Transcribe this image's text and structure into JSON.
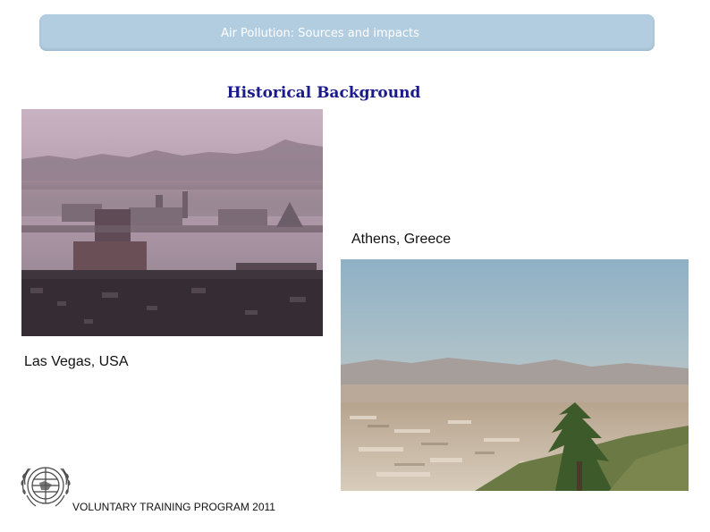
{
  "header": {
    "title": "Air Pollution: Sources and impacts"
  },
  "slide": {
    "title": "Historical Background"
  },
  "photos": {
    "las_vegas": {
      "caption": "Las Vegas, USA"
    },
    "athens": {
      "caption": "Athens, Greece"
    }
  },
  "footer": {
    "text": "VOLUNTARY TRAINING PROGRAM 2011"
  },
  "colors": {
    "header_bar": "#b3cde0",
    "title": "#1a1a8c"
  }
}
